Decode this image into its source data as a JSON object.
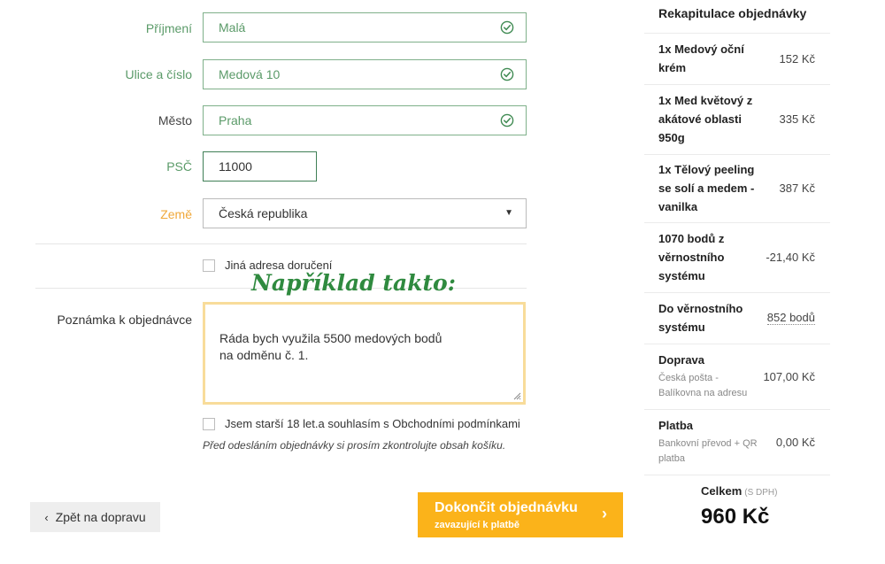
{
  "form": {
    "surname": {
      "label": "Příjmení",
      "value": "Malá"
    },
    "street": {
      "label": "Ulice a číslo",
      "value": "Medová 10"
    },
    "city": {
      "label": "Město",
      "value": "Praha"
    },
    "zip": {
      "label": "PSČ",
      "value": "11000"
    },
    "country": {
      "label": "Země",
      "value": "Česká republika"
    },
    "alt_address": {
      "label": "Jiná adresa doručení"
    },
    "note": {
      "label": "Poznámka k objednávce",
      "value": "Ráda bych využila 5500 medových bodů\nna odměnu č. 1."
    },
    "terms": {
      "label": "Jsem starší 18 let.a souhlasím s Obchodními podmínkami"
    },
    "check_note": "Před odesláním objednávky si prosím zkontrolujte obsah košíku."
  },
  "annotation": "Například takto:",
  "buttons": {
    "back": "Zpět na dopravu",
    "submit_main": "Dokončit objednávku",
    "submit_sub": "zavazující k platbě"
  },
  "summary": {
    "title": "Rekapitulace objednávky",
    "items": [
      {
        "name": "1x Medový oční krém",
        "price": "152 Kč"
      },
      {
        "name": "1x Med květový z akátové oblasti 950g",
        "price": "335 Kč"
      },
      {
        "name": "1x Tělový peeling se solí a medem - vanilka",
        "price": "387 Kč"
      },
      {
        "name": "1070 bodů z věrnostního systému",
        "price": "-21,40 Kč"
      },
      {
        "name": "Do věrnostního systému",
        "price": "852 bodů"
      },
      {
        "name": "Doprava",
        "sub": "Česká pošta - Balíkovna na adresu",
        "price": "107,00 Kč"
      },
      {
        "name": "Platba",
        "sub": "Bankovní převod + QR platba",
        "price": "0,00 Kč"
      }
    ],
    "total_label": "Celkem",
    "total_dph": "(S DPH)",
    "total_value": "960 Kč"
  },
  "colors": {
    "accent": "#fbb31a",
    "valid": "#5a9a68"
  },
  "icons": {
    "valid": "check-circle-icon",
    "select": "caret-down-icon",
    "back": "chevron-left-icon",
    "next": "chevron-right-icon"
  }
}
